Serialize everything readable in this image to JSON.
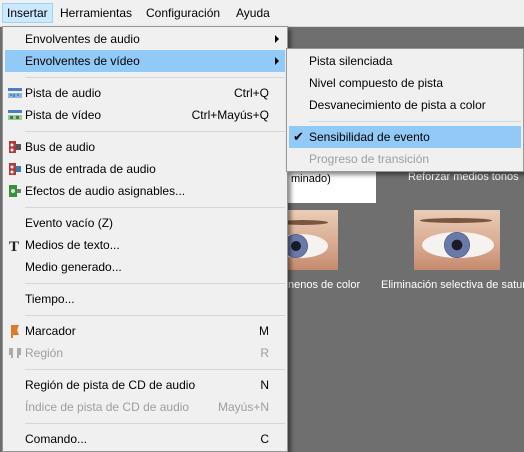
{
  "menubar": {
    "items": [
      {
        "label": "Insertar"
      },
      {
        "label": "Herramientas"
      },
      {
        "label": "Configuración"
      },
      {
        "label": "Ayuda"
      }
    ]
  },
  "background": {
    "caption_1": "minado)",
    "caption_2": "Reforzar medios tonos",
    "caption_3": "nenos de color",
    "caption_4": "Eliminación selectiva de satura"
  },
  "insert_menu": {
    "items": [
      {
        "label": "Envolventes de audio"
      },
      {
        "label": "Envolventes de vídeo"
      },
      {
        "label": "Pista de audio",
        "shortcut": "Ctrl+Q"
      },
      {
        "label": "Pista de vídeo",
        "shortcut": "Ctrl+Mayús+Q"
      },
      {
        "label": "Bus de audio"
      },
      {
        "label": "Bus de entrada de audio"
      },
      {
        "label": "Efectos de audio asignables..."
      },
      {
        "label": "Evento vacío (Z)"
      },
      {
        "label": "Medios de texto..."
      },
      {
        "label": "Medio generado..."
      },
      {
        "label": "Tiempo..."
      },
      {
        "label": "Marcador",
        "shortcut": "M"
      },
      {
        "label": "Región",
        "shortcut": "R"
      },
      {
        "label": "Región de pista de CD de audio",
        "shortcut": "N"
      },
      {
        "label": "Índice de pista de CD de audio",
        "shortcut": "Mayús+N"
      },
      {
        "label": "Comando...",
        "shortcut": "C"
      }
    ]
  },
  "video_envelopes_submenu": {
    "items": [
      {
        "label": "Pista silenciada"
      },
      {
        "label": "Nivel compuesto de pista"
      },
      {
        "label": "Desvanecimiento de pista a color"
      },
      {
        "label": "Sensibilidad de evento",
        "checked": "✔"
      },
      {
        "label": "Progreso de transición"
      }
    ]
  }
}
